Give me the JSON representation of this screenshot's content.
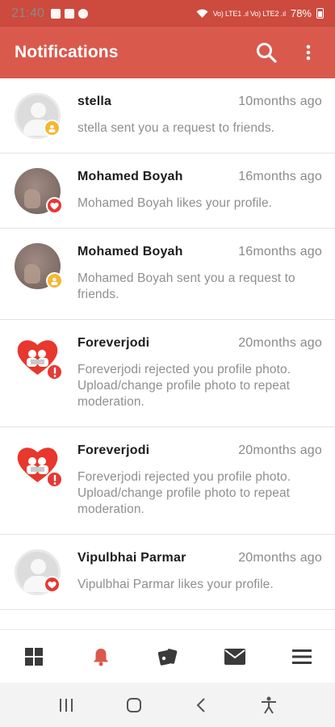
{
  "status_bar": {
    "time": "21:40",
    "network": "Vo) LTE1 .ıl Vo) LTE2 .ıl",
    "battery": "78%"
  },
  "app_bar": {
    "title": "Notifications",
    "search_icon": "search-icon",
    "more_icon": "more-vertical-icon",
    "color": "#d9594d"
  },
  "notifications": [
    {
      "name": "stella",
      "time": "10months ago",
      "message": "stella sent you a request to friends.",
      "avatar": "default",
      "badge": "friend"
    },
    {
      "name": "Mohamed Boyah",
      "time": "16months ago",
      "message": "Mohamed Boyah likes your profile.",
      "avatar": "photo",
      "badge": "like"
    },
    {
      "name": "Mohamed Boyah",
      "time": "16months ago",
      "message": "Mohamed Boyah sent you a request to friends.",
      "avatar": "photo",
      "badge": "friend"
    },
    {
      "name": "Foreverjodi",
      "time": "20months ago",
      "message": "Foreverjodi rejected you profile photo. Upload/change profile photo to repeat moderation.",
      "avatar": "logo",
      "badge": "alert"
    },
    {
      "name": "Foreverjodi",
      "time": "20months ago",
      "message": "Foreverjodi rejected you profile photo. Upload/change profile photo to repeat moderation.",
      "avatar": "logo",
      "badge": "alert"
    },
    {
      "name": "Vipulbhai Parmar",
      "time": "20months ago",
      "message": "Vipulbhai Parmar likes your profile.",
      "avatar": "default",
      "badge": "like"
    }
  ],
  "bottom_nav": [
    {
      "icon": "grid-icon",
      "active": false
    },
    {
      "icon": "bell-icon",
      "active": true
    },
    {
      "icon": "cards-icon",
      "active": false
    },
    {
      "icon": "mail-icon",
      "active": false
    },
    {
      "icon": "menu-icon",
      "active": false
    }
  ],
  "colors": {
    "accent": "#d9594d",
    "badge_friend": "#f5b731",
    "badge_like": "#e53935"
  }
}
